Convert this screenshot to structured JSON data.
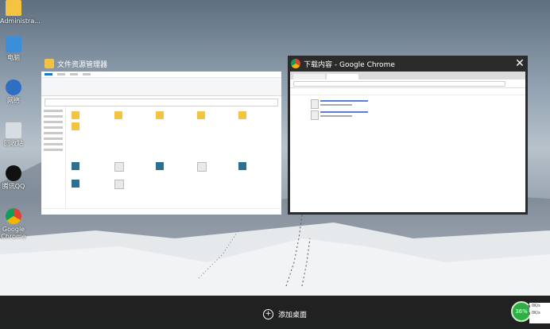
{
  "desktop": {
    "icons": [
      {
        "label": "Administra..."
      },
      {
        "label": "电脑"
      },
      {
        "label": "网络"
      },
      {
        "label": "回收站"
      },
      {
        "label": "腾讯QQ"
      },
      {
        "label": "Google Chrome"
      }
    ]
  },
  "task_view": {
    "explorer": {
      "title": "文件资源管理器"
    },
    "chrome": {
      "title": "下载内容 - Google Chrome",
      "close_symbol": "✕"
    }
  },
  "bottom_bar": {
    "add_desktop_symbol": "+",
    "add_desktop_label": "添加桌面"
  },
  "network_widget": {
    "percent": "36%",
    "up": "0K/s",
    "down": "0K/s"
  },
  "colors": {
    "accent_green": "#2fae44",
    "folder_yellow": "#f5c342",
    "chrome_link": "#5b7fd9"
  }
}
